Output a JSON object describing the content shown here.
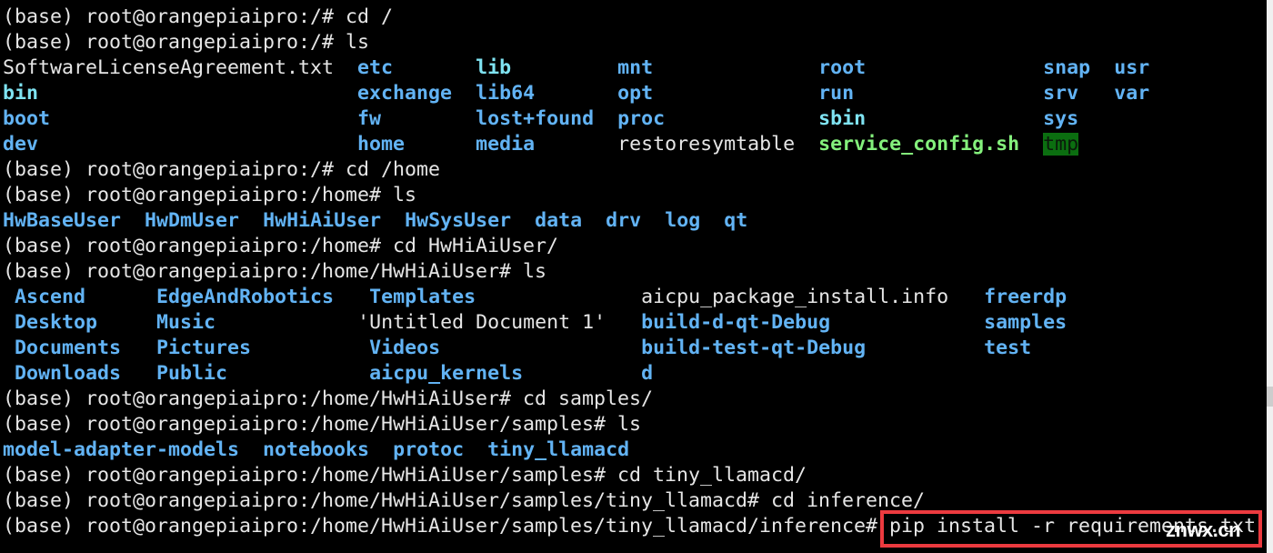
{
  "terminal": {
    "prompt_base": "(base) root@orangepiaipro:",
    "blocks": [
      {
        "type": "cmd",
        "cwd": "/",
        "cmd": "cd /"
      },
      {
        "type": "cmd",
        "cwd": "/",
        "cmd": "ls"
      },
      {
        "type": "grid",
        "id": "root",
        "rows": [
          [
            {
              "t": "SoftwareLicenseAgreement.txt",
              "c": "plain"
            },
            {
              "t": "etc",
              "c": "dir"
            },
            {
              "t": "lib",
              "c": "link"
            },
            {
              "t": "mnt",
              "c": "dir"
            },
            {
              "t": "root",
              "c": "dir"
            },
            {
              "t": "snap",
              "c": "dir"
            },
            {
              "t": "usr",
              "c": "dir"
            }
          ],
          [
            {
              "t": "bin",
              "c": "link"
            },
            {
              "t": "exchange",
              "c": "dir"
            },
            {
              "t": "lib64",
              "c": "dir"
            },
            {
              "t": "opt",
              "c": "dir"
            },
            {
              "t": "run",
              "c": "dir"
            },
            {
              "t": "srv",
              "c": "dir"
            },
            {
              "t": "var",
              "c": "dir"
            }
          ],
          [
            {
              "t": "boot",
              "c": "dir"
            },
            {
              "t": "fw",
              "c": "dir"
            },
            {
              "t": "lost+found",
              "c": "dir"
            },
            {
              "t": "proc",
              "c": "dir"
            },
            {
              "t": "sbin",
              "c": "link"
            },
            {
              "t": "sys",
              "c": "dir"
            }
          ],
          [
            {
              "t": "dev",
              "c": "dir"
            },
            {
              "t": "home",
              "c": "dir"
            },
            {
              "t": "media",
              "c": "dir"
            },
            {
              "t": "restoresymtable",
              "c": "plain"
            },
            {
              "t": "service_config.sh",
              "c": "exec"
            },
            {
              "t": "tmp",
              "c": "sticky"
            }
          ]
        ]
      },
      {
        "type": "cmd",
        "cwd": "/",
        "cmd": "cd /home"
      },
      {
        "type": "cmd",
        "cwd": "/home",
        "cmd": "ls"
      },
      {
        "type": "flat",
        "items": [
          {
            "t": "HwBaseUser",
            "c": "dir"
          },
          {
            "t": "HwDmUser",
            "c": "dir"
          },
          {
            "t": "HwHiAiUser",
            "c": "dir"
          },
          {
            "t": "HwSysUser",
            "c": "dir"
          },
          {
            "t": "data",
            "c": "dir"
          },
          {
            "t": "drv",
            "c": "dir"
          },
          {
            "t": "log",
            "c": "dir"
          },
          {
            "t": "qt",
            "c": "dir"
          }
        ]
      },
      {
        "type": "cmd",
        "cwd": "/home",
        "cmd": "cd HwHiAiUser/"
      },
      {
        "type": "cmd",
        "cwd": "/home/HwHiAiUser",
        "cmd": "ls"
      },
      {
        "type": "grid",
        "id": "user",
        "rows": [
          [
            {
              "t": "Ascend",
              "c": "dir"
            },
            {
              "t": "EdgeAndRobotics",
              "c": "dir"
            },
            {
              "t": "Templates",
              "c": "dir"
            },
            {
              "t": "aicpu_package_install.info",
              "c": "plain"
            },
            {
              "t": "freerdp",
              "c": "dir"
            }
          ],
          [
            {
              "t": "Desktop",
              "c": "dir"
            },
            {
              "t": "Music",
              "c": "dir"
            },
            {
              "t": "'Untitled Document 1'",
              "c": "plain"
            },
            {
              "t": "build-d-qt-Debug",
              "c": "dir"
            },
            {
              "t": "samples",
              "c": "dir"
            }
          ],
          [
            {
              "t": "Documents",
              "c": "dir"
            },
            {
              "t": "Pictures",
              "c": "dir"
            },
            {
              "t": "Videos",
              "c": "dir"
            },
            {
              "t": "build-test-qt-Debug",
              "c": "dir"
            },
            {
              "t": "test",
              "c": "dir"
            }
          ],
          [
            {
              "t": "Downloads",
              "c": "dir"
            },
            {
              "t": "Public",
              "c": "dir"
            },
            {
              "t": "aicpu_kernels",
              "c": "dir"
            },
            {
              "t": "d",
              "c": "dir"
            }
          ]
        ]
      },
      {
        "type": "cmd",
        "cwd": "/home/HwHiAiUser",
        "cmd": "cd samples/"
      },
      {
        "type": "cmd",
        "cwd": "/home/HwHiAiUser/samples",
        "cmd": "ls"
      },
      {
        "type": "flat",
        "items": [
          {
            "t": "model-adapter-models",
            "c": "dir"
          },
          {
            "t": "notebooks",
            "c": "dir"
          },
          {
            "t": "protoc",
            "c": "dir"
          },
          {
            "t": "tiny_llamacd",
            "c": "dir"
          }
        ]
      },
      {
        "type": "cmd",
        "cwd": "/home/HwHiAiUser/samples",
        "cmd": "cd tiny_llamacd/"
      },
      {
        "type": "cmd",
        "cwd": "/home/HwHiAiUser/samples/tiny_llamacd",
        "cmd": "cd inference/"
      },
      {
        "type": "cmd",
        "cwd": "/home/HwHiAiUser/samples/tiny_llamacd/inference",
        "cmd": "pip install -r requirements.txt",
        "highlighted": true
      }
    ]
  },
  "watermark": "znwx.cn",
  "colors": {
    "directory": "#62b3f4",
    "symlink": "#7fe3f2",
    "executable": "#84f07c",
    "sticky_bg": "#0b6e10",
    "highlight_box": "#ec3a3f",
    "background": "#000000"
  }
}
